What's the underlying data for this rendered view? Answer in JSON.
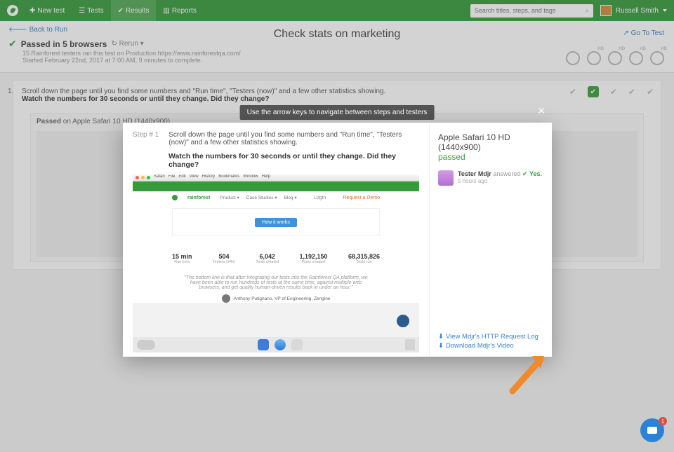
{
  "nav": {
    "new_test": "New test",
    "tests": "Tests",
    "results": "Results",
    "reports": "Reports",
    "search_placeholder": "Search titles, steps, and tags",
    "user_name": "Russell Smith"
  },
  "run": {
    "back": "Back to Run",
    "title": "Check stats on marketing",
    "go_to_test": "Go To Test",
    "pass_headline": "Passed in 5 browsers",
    "rerun": "Rerun",
    "sub1": "15 Rainforest testers ran this test on Production https://www.rainforestqa.com/",
    "sub2": "Started February 22nd, 2017 at 7:00 AM, 9 minutes to complete."
  },
  "step": {
    "num": "1.",
    "line1": "Scroll down the page until you find some numbers and \"Run time\", \"Testers (now)\" and a few other statistics showing.",
    "line2": "Watch the numbers for 30 seconds or until they change. Did they change?",
    "passed_on": "Passed",
    "passed_on_tail": " on Apple Safari 10 HD (1440x900)"
  },
  "hint": "Use the arrow keys to navigate between steps and testers",
  "modal": {
    "step_label": "Step # 1",
    "instr": "Scroll down the page until you find some numbers and \"Run time\", \"Testers (now)\" and a few other statistics showing.",
    "question": "Watch the numbers for 30 seconds or until they change. Did they change?",
    "platform": "Apple Safari 10 HD (1440x900)",
    "status": "passed",
    "tester_name": "Tester Mdjr",
    "answered": "answered",
    "yes": "Yes.",
    "time": "5 hours ago",
    "dl_http": "View Mdjr's HTTP Request Log",
    "dl_video": "Download Mdjr's Video"
  },
  "shot": {
    "rainforest": "rainforest",
    "menu": [
      "Product",
      "Case Studies",
      "Blog"
    ],
    "login": "Login",
    "demo": "Request a Demo",
    "hiw": "How it works",
    "stats": [
      {
        "v": "15 min",
        "lbl": "Run time"
      },
      {
        "v": "504",
        "lbl": "Testers (24h)"
      },
      {
        "v": "6,042",
        "lbl": "Tests created"
      },
      {
        "v": "1,192,150",
        "lbl": "Runs created"
      },
      {
        "v": "68,315,826",
        "lbl": "Tests run"
      }
    ],
    "quote": "\"The bottom line is that after integrating our tests into the Rainforest QA platform, we have been able to run hundreds of tests at the same time, against multiple web browsers, and get quality human-driven results back in under an hour.\"",
    "author": "Anthony Putignano, VP of Engineering, Zengine",
    "mac_menu": [
      "Safari",
      "File",
      "Edit",
      "View",
      "History",
      "Bookmarks",
      "Window",
      "Help"
    ]
  },
  "intercom_badge": "1"
}
